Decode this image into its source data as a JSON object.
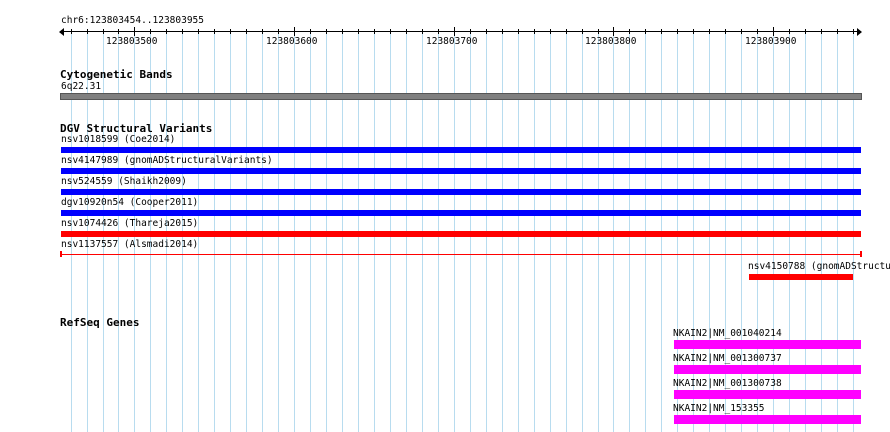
{
  "ruler": {
    "location": "chr6:123803454..123803955",
    "start": 123803454,
    "end": 123803955,
    "major_ticks": [
      123803500,
      123803600,
      123803700,
      123803800,
      123803900
    ]
  },
  "tracks": {
    "cytoband": {
      "title": "Cytogenetic Bands",
      "feature_label": "6q22.31",
      "color": "#7f7f7f"
    },
    "dgv": {
      "title": "DGV Structural Variants",
      "features": [
        {
          "label": "nsv1018599 (Coe2014)",
          "color": "#0000ff",
          "style": "solid",
          "start": 123803454,
          "end": 123803955
        },
        {
          "label": "nsv4147989 (gnomADStructuralVariants)",
          "color": "#0000ff",
          "style": "solid",
          "start": 123803454,
          "end": 123803955
        },
        {
          "label": "nsv524559 (Shaikh2009)",
          "color": "#0000ff",
          "style": "solid",
          "start": 123803454,
          "end": 123803955
        },
        {
          "label": "dgv10920n54 (Cooper2011)",
          "color": "#0000ff",
          "style": "solid",
          "start": 123803454,
          "end": 123803955
        },
        {
          "label": "nsv1074426 (Thareja2015)",
          "color": "#ff0000",
          "style": "solid",
          "start": 123803454,
          "end": 123803955
        },
        {
          "label": "nsv1137557 (Alsmadi2014)",
          "color": "#ff0000",
          "style": "line",
          "start": 123803454,
          "end": 123803955
        },
        {
          "label": "nsv4150788 (gnomADStructu",
          "color": "#ff0000",
          "style": "solid",
          "start": 123803885,
          "end": 123803950
        }
      ]
    },
    "refseq": {
      "title": "RefSeq Genes",
      "color": "#ff00ff",
      "features": [
        {
          "label": "NKAIN2|NM_001040214",
          "start": 123803838,
          "end": 123803955
        },
        {
          "label": "NKAIN2|NM_001300737",
          "start": 123803838,
          "end": 123803955
        },
        {
          "label": "NKAIN2|NM_001300738",
          "start": 123803838,
          "end": 123803955
        },
        {
          "label": "NKAIN2|NM_153355",
          "start": 123803838,
          "end": 123803955
        }
      ]
    }
  }
}
